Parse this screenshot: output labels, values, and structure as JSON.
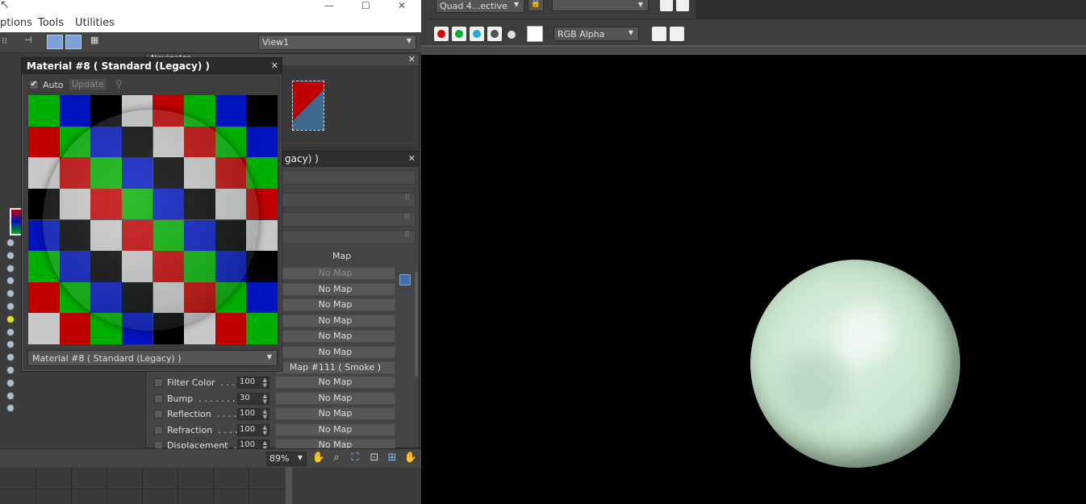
{
  "menubar": {
    "items": [
      "ptions",
      "Tools",
      "Utilities"
    ]
  },
  "toolbar": {
    "view_select": "View1"
  },
  "navigator": {
    "title": "Navigator"
  },
  "editor": {
    "title": "gacy) )",
    "map_header": "Map",
    "map_rows": [
      {
        "value": "No Map",
        "dim": true
      },
      {
        "value": "No Map"
      },
      {
        "value": "No Map"
      },
      {
        "value": "No Map"
      },
      {
        "value": "No Map"
      },
      {
        "value": "No Map"
      },
      {
        "value": "Map #111  ( Smoke )"
      }
    ],
    "params": [
      {
        "label": "Filter Color  . . . .",
        "amount": "100",
        "map": "No Map"
      },
      {
        "label": "Bump  . . . . . . . .",
        "amount": "30",
        "map": "No Map"
      },
      {
        "label": "Reflection  . . . .",
        "amount": "100",
        "map": "No Map"
      },
      {
        "label": "Refraction  . . . .",
        "amount": "100",
        "map": "No Map"
      },
      {
        "label": "Displacement  . .",
        "amount": "100",
        "map": "No Map"
      }
    ]
  },
  "bottombar": {
    "zoom": "89%"
  },
  "material_window": {
    "title": "Material #8  ( Standard (Legacy) )",
    "auto_label": "Auto",
    "update_label": "Update",
    "material_select": "Material #8  ( Standard (Legacy) )"
  },
  "render": {
    "view_select": "Quad 4...ective",
    "channel_select": "RGB Alpha"
  },
  "checker_colors": {
    "r": "#c00000",
    "g": "#00b000",
    "b": "#0014c0",
    "k": "#000000",
    "w": "#c8c8c8"
  },
  "checker_rows": [
    "gbkwrgbk",
    "rgbkwrgb",
    "wrgbkwrg",
    "kwrgbkwr",
    "bkwrgbkw",
    "gbkwrgbk",
    "rgbkwrgb",
    "wrgbkwrg"
  ]
}
